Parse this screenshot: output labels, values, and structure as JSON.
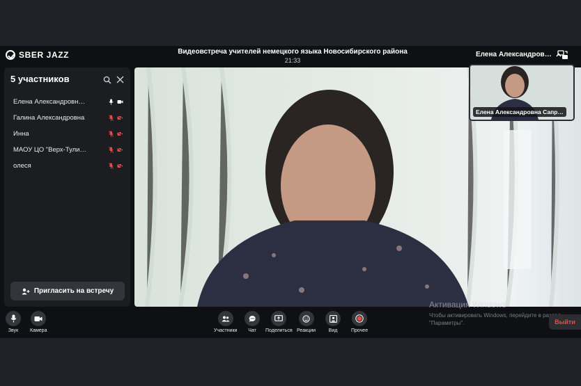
{
  "header": {
    "logo": "SBER JAZZ",
    "title": "Видеовстреча учителей немецкого языка Новосибирского района",
    "time": "21:33",
    "speaker": "Елена Александров…"
  },
  "sidebar": {
    "title": "5 участников",
    "participants": [
      {
        "name": "Елена Александровн…",
        "mic": "on",
        "cam": "on"
      },
      {
        "name": "Галина Александровна",
        "mic": "off",
        "cam": "off"
      },
      {
        "name": "Инна",
        "mic": "off",
        "cam": "off"
      },
      {
        "name": "МАОУ ЦО \"Верх-Тули…",
        "mic": "off",
        "cam": "off"
      },
      {
        "name": "олеся",
        "mic": "off",
        "cam": "off"
      }
    ],
    "invite_label": "Пригласить на встречу"
  },
  "selfview": {
    "label": "Елена Александровна Сапр…"
  },
  "controls": {
    "sound": "Звук",
    "camera": "Камера",
    "participants": "Участники",
    "chat": "Чат",
    "share": "Поделиться",
    "reactions": "Реакции",
    "view": "Вид",
    "more": "Прочее",
    "leave": "Выйти"
  },
  "windows_activation": {
    "title": "Активация Windows",
    "text": "Чтобы активировать Windows, перейдите в раздел \"Параметры\"."
  },
  "colors": {
    "accent_red": "#ef4a4a",
    "panel": "#1c1d21",
    "bg": "#0f1013"
  }
}
